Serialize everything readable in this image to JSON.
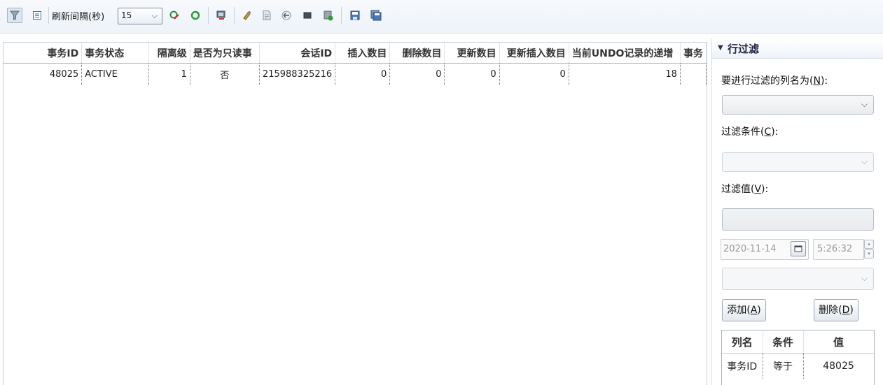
{
  "toolbar": {
    "refresh_label": "刷新间隔(秒)",
    "refresh_value": "15",
    "icons": [
      "filter-icon",
      "detail-view-icon",
      "refresh-stop-icon",
      "refresh-icon",
      "monitor-icon",
      "tool-icon",
      "page-icon",
      "back-icon",
      "stop-icon",
      "export-icon",
      "save-icon",
      "save-as-icon"
    ]
  },
  "grid": {
    "columns": [
      "事务ID",
      "事务状态",
      "隔离级",
      "是否为只读事",
      "会话ID",
      "插入数目",
      "删除数目",
      "更新数目",
      "更新插入数目",
      "当前UNDO记录的递增",
      "事务"
    ],
    "rows": [
      [
        "48025",
        "ACTIVE",
        "1",
        "否",
        "215988325216",
        "0",
        "0",
        "0",
        "0",
        "18",
        ""
      ]
    ]
  },
  "filter": {
    "title": "行过滤",
    "column_label": "要进行过滤的列名为(",
    "column_key": "N",
    "condition_label": "过滤条件(",
    "condition_key": "C",
    "value_label": "过滤值(",
    "value_key": "V",
    "label_suffix": "):",
    "date_value": "2020-11-14",
    "time_value": "5:26:32",
    "add_label": "添加(",
    "add_key": "A",
    "delete_label": "删除(",
    "delete_key": "D",
    "btn_suffix": ")",
    "table": {
      "headers": [
        "列名",
        "条件",
        "值"
      ],
      "rows": [
        [
          "事务ID",
          "等于",
          "48025"
        ]
      ]
    }
  }
}
